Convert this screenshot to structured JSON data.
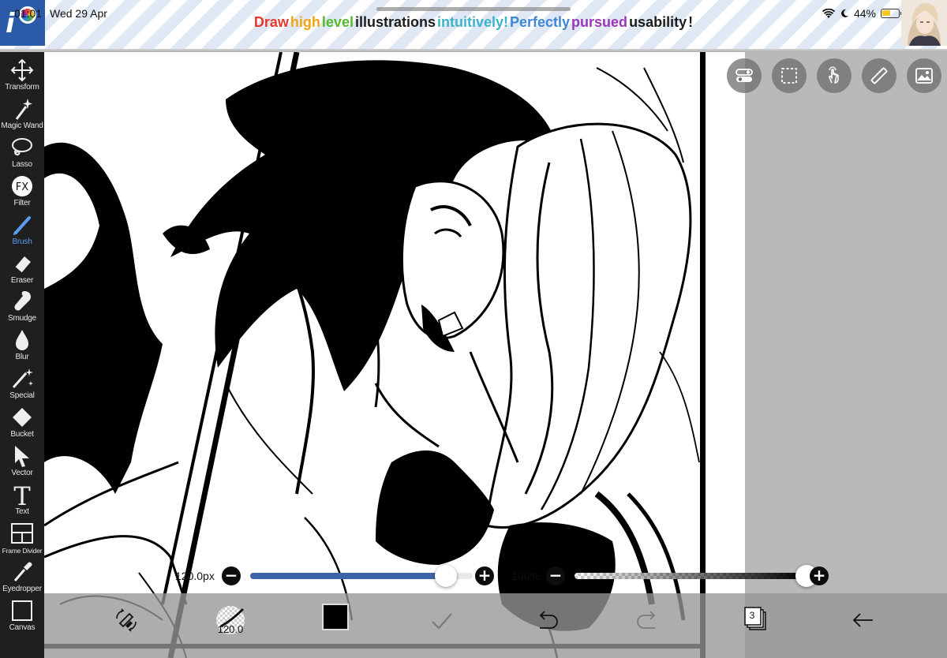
{
  "status_bar": {
    "time": "01:01",
    "date": "Wed 29 Apr",
    "battery": "44%"
  },
  "banner": {
    "slogan_words": [
      {
        "text": "Draw",
        "color": "#e8382f"
      },
      {
        "text": "high",
        "color": "#f0a513"
      },
      {
        "text": "level",
        "color": "#58b82f"
      },
      {
        "text": "illustrations",
        "color": "#1d1d1d"
      },
      {
        "text": "intuitively!",
        "color": "#3fb3c9"
      },
      {
        "text": "Perfectly",
        "color": "#3e86d8"
      },
      {
        "text": "pursued",
        "color": "#9a39b8"
      },
      {
        "text": "usability",
        "color": "#1d1d1d"
      },
      {
        "text": "!",
        "color": "#1d1d1d"
      }
    ]
  },
  "tools": [
    {
      "name": "transform",
      "label": "Transform",
      "icon": "move-arrows-icon"
    },
    {
      "name": "magic-wand",
      "label": "Magic Wand",
      "icon": "magic-wand-icon"
    },
    {
      "name": "lasso",
      "label": "Lasso",
      "icon": "lasso-icon"
    },
    {
      "name": "filter",
      "label": "Filter",
      "icon": "fx-icon"
    },
    {
      "name": "brush",
      "label": "Brush",
      "icon": "brush-icon",
      "active": true
    },
    {
      "name": "eraser",
      "label": "Eraser",
      "icon": "eraser-icon"
    },
    {
      "name": "smudge",
      "label": "Smudge",
      "icon": "smudge-icon"
    },
    {
      "name": "blur",
      "label": "Blur",
      "icon": "droplet-icon"
    },
    {
      "name": "special",
      "label": "Special",
      "icon": "special-brush-icon"
    },
    {
      "name": "bucket",
      "label": "Bucket",
      "icon": "bucket-icon"
    },
    {
      "name": "vector",
      "label": "Vector",
      "icon": "cursor-arrow-icon"
    },
    {
      "name": "text",
      "label": "Text",
      "icon": "text-t-icon"
    },
    {
      "name": "frame-divider",
      "label": "Frame Divider",
      "icon": "frame-divider-icon"
    },
    {
      "name": "eyedropper",
      "label": "Eyedropper",
      "icon": "eyedropper-icon"
    },
    {
      "name": "canvas",
      "label": "Canvas",
      "icon": "canvas-icon"
    }
  ],
  "right_buttons": [
    {
      "name": "toggle-panel",
      "icon": "toggle-icon"
    },
    {
      "name": "selection",
      "icon": "dashed-selection-icon"
    },
    {
      "name": "touch",
      "icon": "hand-touch-icon"
    },
    {
      "name": "ruler",
      "icon": "ruler-icon"
    },
    {
      "name": "material",
      "icon": "image-icon"
    }
  ],
  "brush": {
    "size_label": "120.0px",
    "size_short": "120.0",
    "size_fraction": 0.88,
    "opacity_label": "100%",
    "opacity_fraction": 1.0,
    "color": "#000000",
    "slider_color": "#3f63a8"
  },
  "layers": {
    "count": "3"
  }
}
